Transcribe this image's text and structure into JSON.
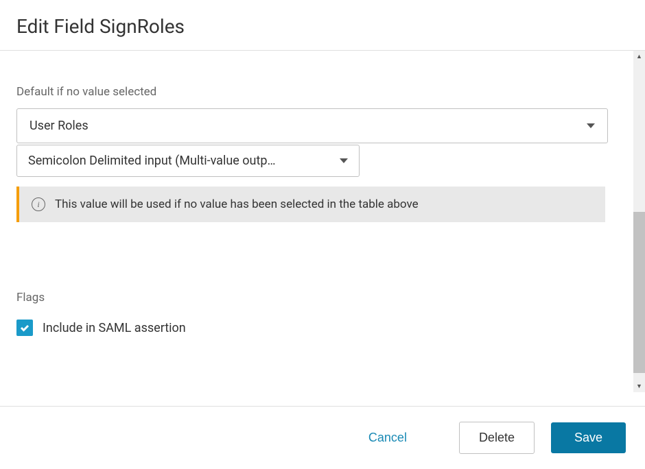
{
  "header": {
    "title": "Edit Field SignRoles"
  },
  "form": {
    "default_label": "Default if no value selected",
    "default_select_value": "User Roles",
    "format_select_value": "Semicolon Delimited input (Multi-value outp…",
    "info_message": "This value will be used if no value has been selected in the table above"
  },
  "flags": {
    "section_label": "Flags",
    "include_saml_label": "Include in SAML assertion",
    "include_saml_checked": true
  },
  "footer": {
    "cancel_label": "Cancel",
    "delete_label": "Delete",
    "save_label": "Save"
  }
}
